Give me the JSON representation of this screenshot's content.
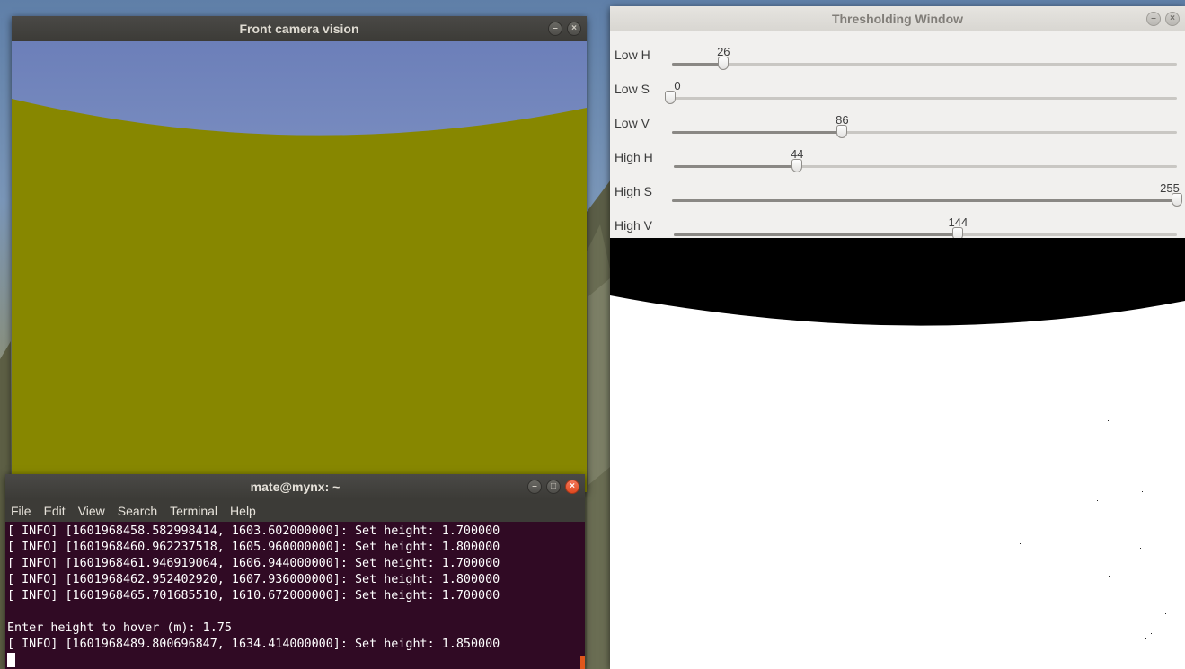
{
  "camera_window": {
    "title": "Front camera vision"
  },
  "threshold_window": {
    "title": "Thresholding Window",
    "sliders": [
      {
        "label": "Low H",
        "value": "26",
        "fraction": 0.102
      },
      {
        "label": "Low S",
        "value": "0",
        "fraction": 0.0
      },
      {
        "label": "Low V",
        "value": "86",
        "fraction": 0.337
      },
      {
        "label": "High H",
        "value": "44",
        "fraction": 0.245
      },
      {
        "label": "High S",
        "value": "255",
        "fraction": 1.0
      },
      {
        "label": "High V",
        "value": "144",
        "fraction": 0.565
      }
    ]
  },
  "terminal": {
    "title": "mate@mynx: ~",
    "menu": [
      "File",
      "Edit",
      "View",
      "Search",
      "Terminal",
      "Help"
    ],
    "lines": [
      "[ INFO] [1601968458.582998414, 1603.602000000]: Set height: 1.700000",
      "[ INFO] [1601968460.962237518, 1605.960000000]: Set height: 1.800000",
      "[ INFO] [1601968461.946919064, 1606.944000000]: Set height: 1.700000",
      "[ INFO] [1601968462.952402920, 1607.936000000]: Set height: 1.800000",
      "[ INFO] [1601968465.701685510, 1610.672000000]: Set height: 1.700000",
      "",
      "Enter height to hover (m): 1.75",
      "[ INFO] [1601968489.800696847, 1634.414000000]: Set height: 1.850000"
    ]
  },
  "icons": {
    "minimize": "minimize-icon",
    "maximize": "maximize-icon",
    "close": "close-icon"
  },
  "colors": {
    "ground": "#878700",
    "terminal_bg": "#300a24",
    "close_button": "#e0491f"
  }
}
